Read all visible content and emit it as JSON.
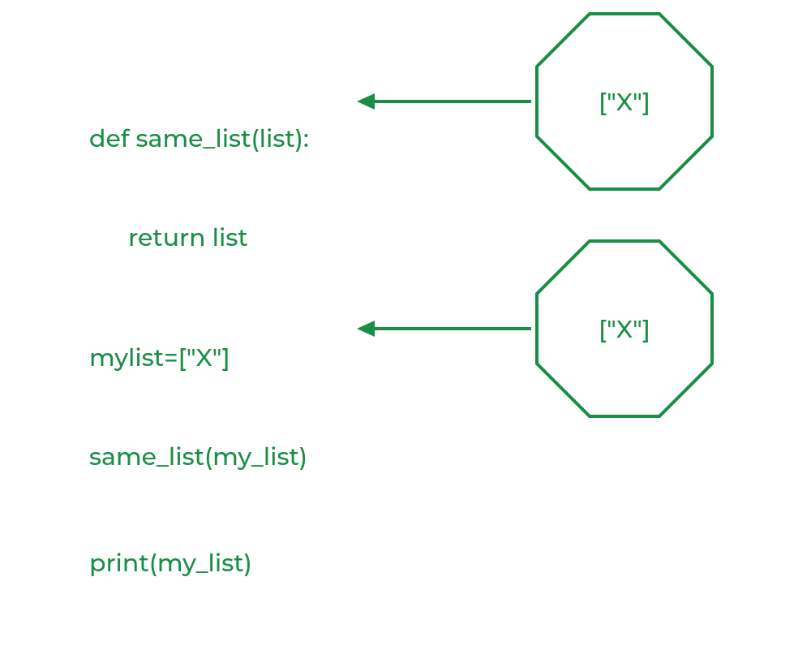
{
  "colors": {
    "green": "#198e44"
  },
  "diagram": {
    "top": {
      "code": {
        "line1": "def same_list(list):",
        "line2": "return list"
      },
      "node_label": "[\"X\"]"
    },
    "bottom": {
      "code": {
        "line1": "mylist=[\"X\"]",
        "line2": "same_list(my_list)",
        "line3": "print(my_list)"
      },
      "node_label": "[\"X\"]"
    }
  }
}
